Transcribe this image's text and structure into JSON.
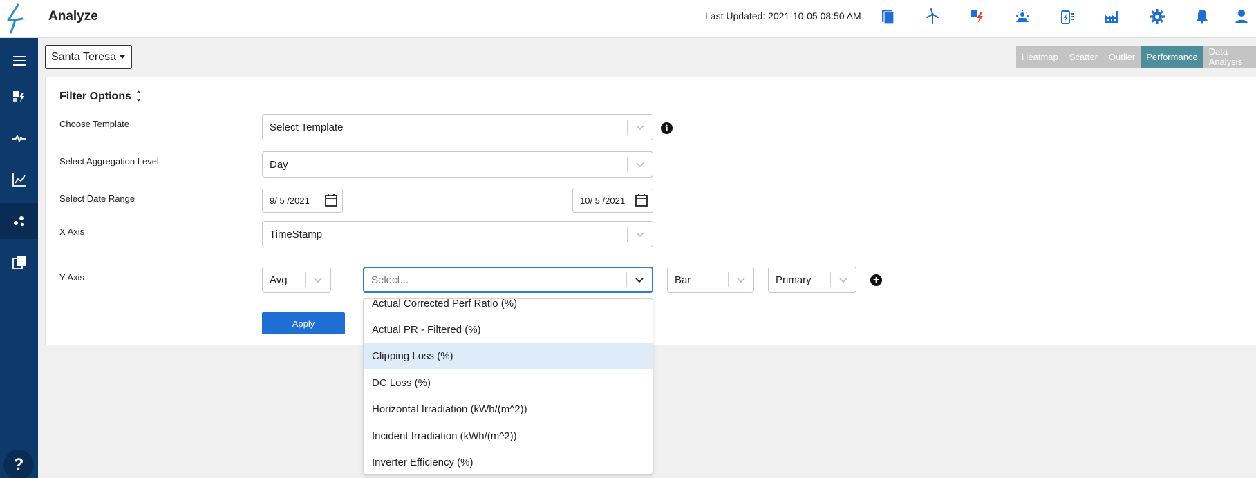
{
  "header": {
    "app_title": "Analyze",
    "last_updated": "Last Updated: 2021-10-05 08:50 AM",
    "icons": [
      "reports-icon",
      "wind-turbine-icon",
      "alert-flash-icon",
      "solar-panel-icon",
      "battery-icon",
      "factory-icon",
      "settings-gear-icon",
      "notification-bell-icon",
      "user-icon"
    ]
  },
  "sidebar": {
    "items": [
      "menu-icon",
      "flash-map-icon",
      "pulse-icon",
      "line-chart-icon",
      "scatter-icon",
      "documents-icon"
    ],
    "help_label": "?"
  },
  "site": {
    "selected": "Santa Teresa"
  },
  "tabs": [
    {
      "label": "Heatmap",
      "active": false
    },
    {
      "label": "Scatter",
      "active": false
    },
    {
      "label": "Outlier",
      "active": false
    },
    {
      "label": "Performance",
      "active": true
    },
    {
      "label": "Data Analysis",
      "active": false
    }
  ],
  "filter": {
    "title": "Filter Options",
    "template_label": "Choose Template",
    "template_value": "Select Template",
    "aggregation_label": "Select Aggregation Level",
    "aggregation_value": "Day",
    "date_range_label": "Select Date Range",
    "date_start": "9/ 5 /2021",
    "date_end": "10/ 5 /2021",
    "x_axis_label": "X Axis",
    "x_axis_value": "TimeStamp",
    "y_axis_label": "Y Axis",
    "y_agg_value": "Avg",
    "y_metric_placeholder": "Select...",
    "y_chart_type": "Bar",
    "y_axis_side": "Primary",
    "apply_label": "Apply"
  },
  "dropdown": {
    "options": [
      "Actual Corrected Perf Ratio (%)",
      "Actual PR - Filtered (%)",
      "Clipping Loss (%)",
      "DC Loss (%)",
      "Horizontal Irradiation (kWh/(m^2))",
      "Incident Irradiation (kWh/(m^2))",
      "Inverter Efficiency (%)"
    ],
    "highlighted": "Clipping Loss (%)"
  },
  "colors": {
    "sidebar": "#0e3a6b",
    "accent_blue": "#1f6ed4",
    "tab_active": "#4e8d9c",
    "tab_inactive": "#c4c4c4",
    "alert_red": "#e0452b"
  }
}
